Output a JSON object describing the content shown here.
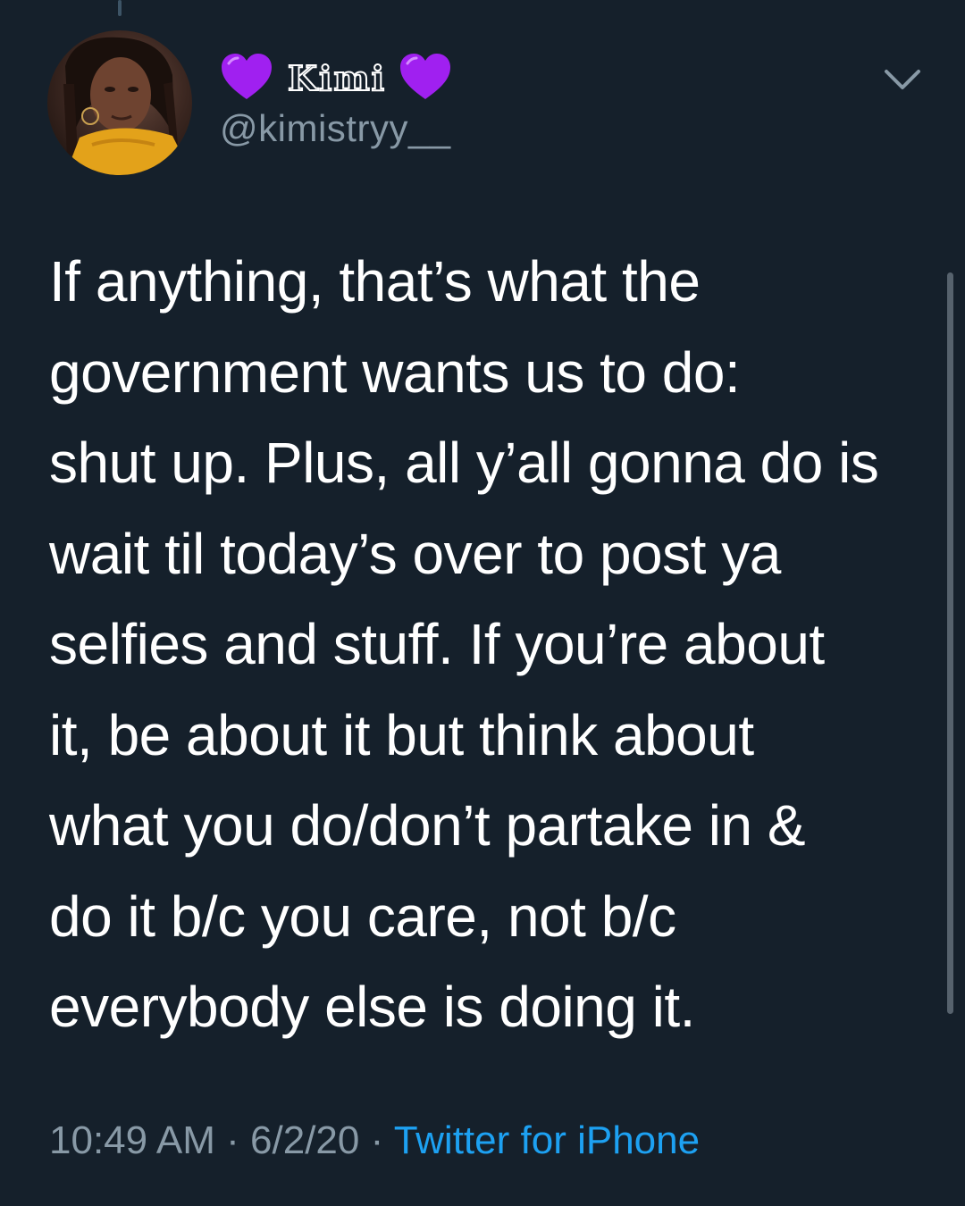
{
  "tweet": {
    "author": {
      "display_name": "Kimi",
      "display_emoji": "purple-heart-icon",
      "handle": "@kimistryy__"
    },
    "text_lines": [
      "If anything, that’s what the",
      "government wants us to do:",
      "shut up. Plus, all y’all gonna do is",
      "wait til today’s over to post ya",
      "selfies and stuff. If you’re about",
      "it, be about it but think about",
      "what you do/don’t partake in &",
      "do it b/c you care, not b/c",
      "everybody else is doing it."
    ],
    "time": "10:49 AM",
    "separator": "·",
    "date": "6/2/20",
    "source": "Twitter for iPhone"
  },
  "colors": {
    "background": "#15202b",
    "text": "#ffffff",
    "secondary_text": "#8899a6",
    "link": "#1da1f2",
    "heart": "#a020f0"
  }
}
